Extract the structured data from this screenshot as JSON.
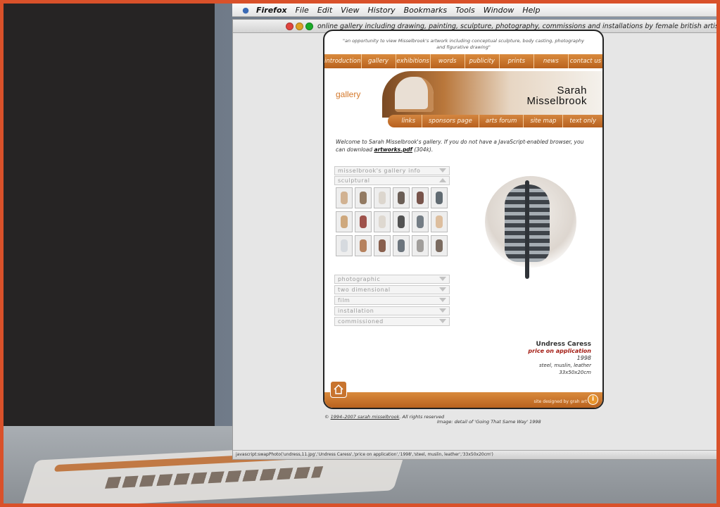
{
  "menubar": {
    "items": [
      "Firefox",
      "File",
      "Edit",
      "View",
      "History",
      "Bookmarks",
      "Tools",
      "Window",
      "Help"
    ]
  },
  "window": {
    "title": "online gallery including drawing, painting, sculpture, photography, commissions and installations by female british artist sarah misselbrook with title"
  },
  "site": {
    "tagline": "\"an opportunity to view Misselbrook's artwork including conceptual sculpture, body casting, photography and figurative drawing\"",
    "nav": [
      "introduction",
      "gallery",
      "exhibitions",
      "words",
      "publicity",
      "prints",
      "news",
      "contact us"
    ],
    "section": "gallery",
    "name_line1": "Sarah",
    "name_line2": "Misselbrook",
    "subnav": [
      "links",
      "sponsors page",
      "arts forum",
      "site map",
      "text only"
    ],
    "intro_before": "Welcome to Sarah Misselbrook's gallery. If you do not have a JavaScript-enabled browser, you can download ",
    "intro_link": "artworks.pdf",
    "intro_after": " (304k).",
    "categories": {
      "info": "misselbrook's gallery info",
      "sculptural": "sculptural",
      "photographic": "photographic",
      "two_dimensional": "two dimensional",
      "film": "film",
      "installation": "installation",
      "commissioned": "commissioned"
    },
    "caption": {
      "title": "Undress Caress",
      "price": "price on application",
      "year": "1998",
      "materials": "steel, muslin, leather",
      "dimensions": "33x50x20cm"
    },
    "credit": "site designed by grah art",
    "copyright_prefix": "©",
    "copyright_link": "1994–2007 sarah misselbrook",
    "copyright_suffix": ". All rights reserved",
    "image_note": "Image: detail of 'Going That Same Way' 1998"
  },
  "statusbar": "javascript:swapPhoto('undress,11.jpg','Undress Caress','price on application','1998','steel, muslin, leather','33x50x20cm')"
}
